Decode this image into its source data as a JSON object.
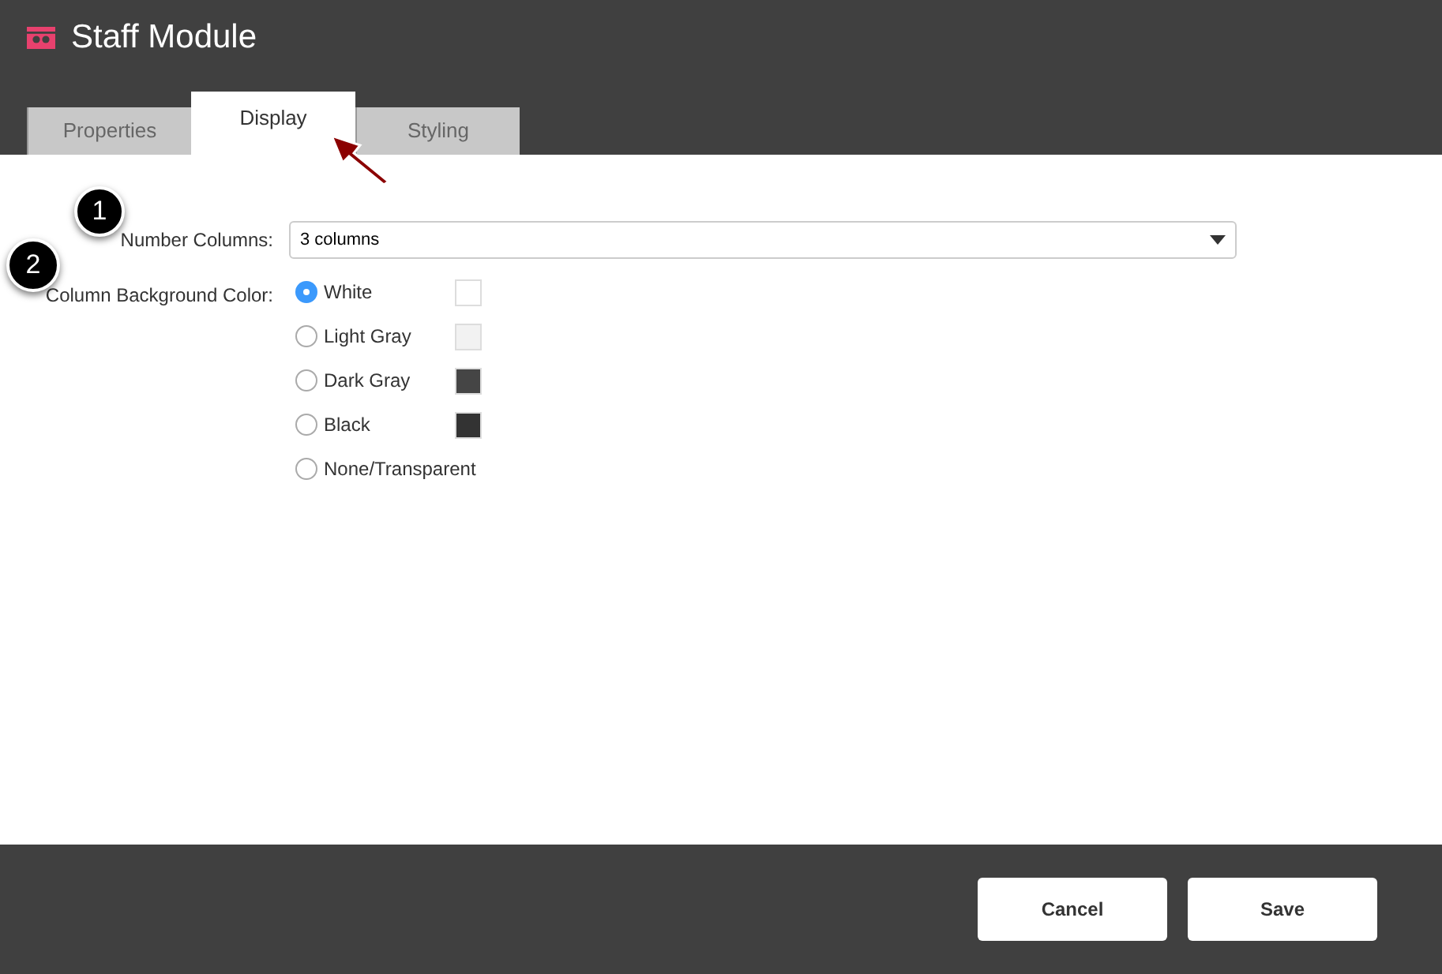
{
  "window": {
    "title": "Staff Module"
  },
  "tabs": [
    {
      "label": "Properties",
      "selected": false
    },
    {
      "label": "Display",
      "selected": true
    },
    {
      "label": "Styling",
      "selected": false
    }
  ],
  "callouts": [
    "1",
    "2"
  ],
  "number_columns": {
    "label": "Number Columns:",
    "value": "3 columns"
  },
  "background_color": {
    "label": "Column Background Color:",
    "options": [
      {
        "label": "White",
        "selected": true,
        "color": "#ffffff"
      },
      {
        "label": "Light Gray",
        "selected": false,
        "color": "#f2f2f2"
      },
      {
        "label": "Dark Gray",
        "selected": false,
        "color": "#454545"
      },
      {
        "label": "Black",
        "selected": false,
        "color": "#333333"
      },
      {
        "label": "None/Transparent",
        "selected": false
      }
    ]
  },
  "buttons": [
    "Cancel",
    "Save"
  ]
}
